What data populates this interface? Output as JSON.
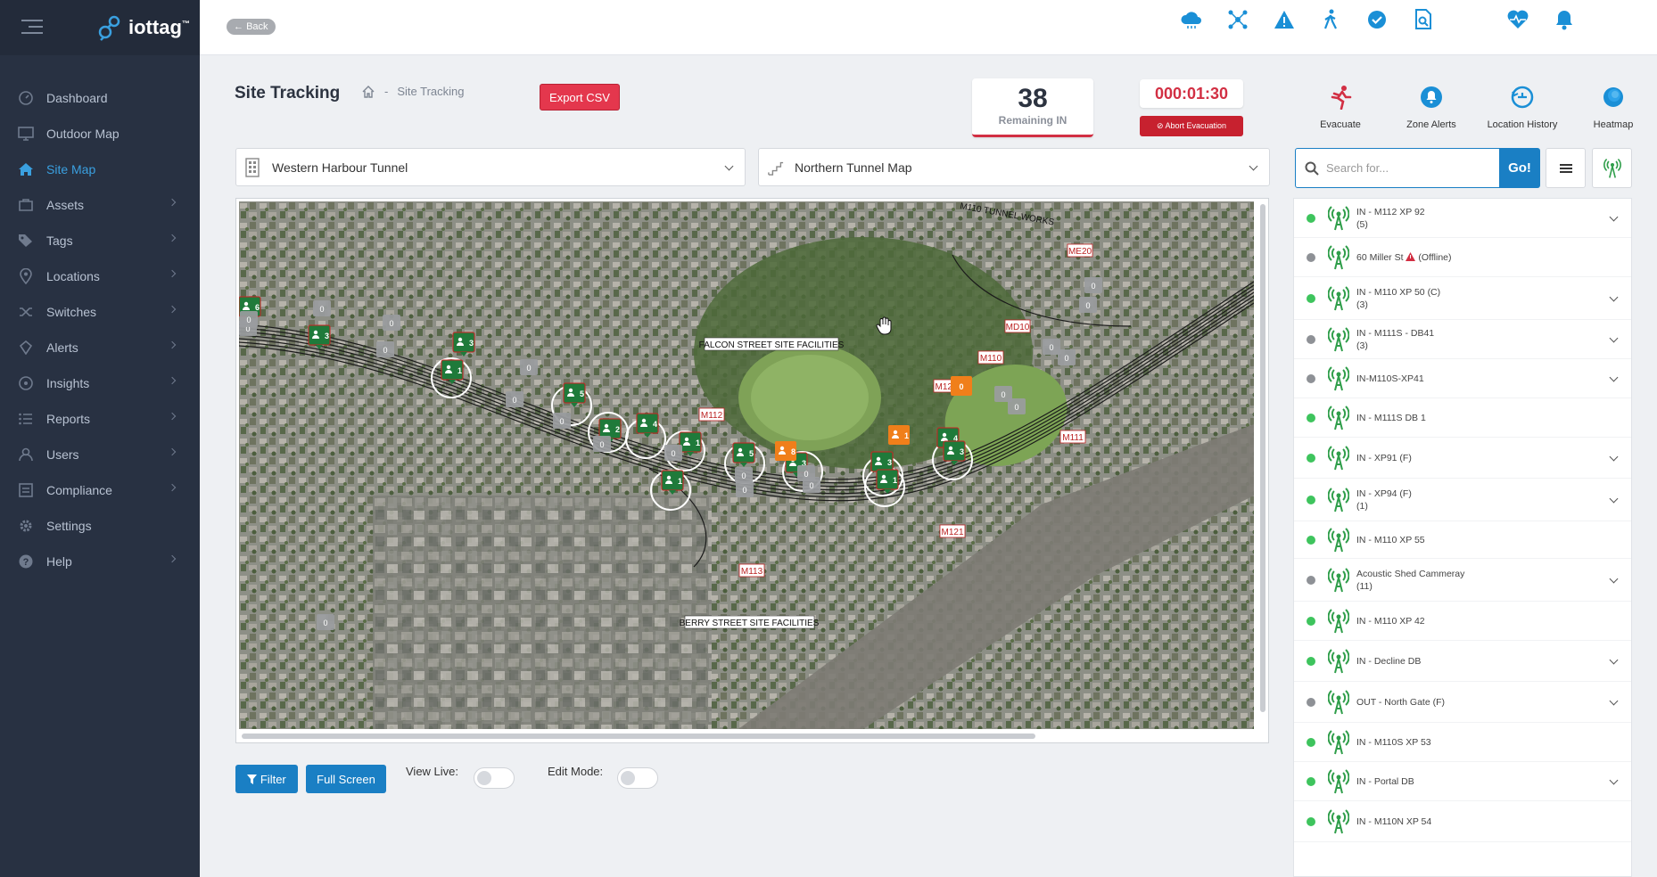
{
  "brand": {
    "name": "iottag",
    "tm": "™"
  },
  "sidebar": {
    "items": [
      {
        "label": "Dashboard",
        "icon": "dashboard-icon",
        "active": false,
        "chevron": false
      },
      {
        "label": "Outdoor Map",
        "icon": "monitor-icon",
        "active": false,
        "chevron": false
      },
      {
        "label": "Site Map",
        "icon": "home-icon",
        "active": true,
        "chevron": false
      },
      {
        "label": "Assets",
        "icon": "assets-icon",
        "active": false,
        "chevron": true
      },
      {
        "label": "Tags",
        "icon": "tag-icon",
        "active": false,
        "chevron": true
      },
      {
        "label": "Locations",
        "icon": "location-pin-icon",
        "active": false,
        "chevron": true
      },
      {
        "label": "Switches",
        "icon": "shuffle-icon",
        "active": false,
        "chevron": true
      },
      {
        "label": "Alerts",
        "icon": "bell-outline-icon",
        "active": false,
        "chevron": true
      },
      {
        "label": "Insights",
        "icon": "insights-icon",
        "active": false,
        "chevron": true
      },
      {
        "label": "Reports",
        "icon": "list-icon",
        "active": false,
        "chevron": true
      },
      {
        "label": "Users",
        "icon": "user-icon",
        "active": false,
        "chevron": true
      },
      {
        "label": "Compliance",
        "icon": "compliance-icon",
        "active": false,
        "chevron": true
      },
      {
        "label": "Settings",
        "icon": "gear-icon",
        "active": false,
        "chevron": false
      },
      {
        "label": "Help",
        "icon": "help-icon",
        "active": false,
        "chevron": true
      }
    ]
  },
  "topbar": {
    "back_label": "Back",
    "icons": [
      "cloud-icon",
      "network-icon",
      "warning-icon",
      "person-walk-icon",
      "check-circle-icon",
      "document-search-icon",
      "heart-pulse-icon",
      "bell-icon"
    ],
    "accent": "#1a8fd6"
  },
  "header": {
    "title": "Site Tracking",
    "breadcrumb": "Site Tracking",
    "export_label": "Export CSV"
  },
  "evacuation": {
    "remaining_count": "38",
    "remaining_label": "Remaining IN",
    "timer": "000:01:30",
    "abort_label": "Abort Evacuation"
  },
  "actions": [
    {
      "label": "Evacuate",
      "icon": "running-person-icon"
    },
    {
      "label": "Zone Alerts",
      "icon": "zone-alert-icon"
    },
    {
      "label": "Location History",
      "icon": "history-icon"
    },
    {
      "label": "Heatmap",
      "icon": "heatmap-icon"
    }
  ],
  "selects": {
    "site": "Western Harbour Tunnel",
    "map": "Northern Tunnel Map"
  },
  "map": {
    "labels": {
      "falcon": "FALCON STREET SITE FACILITIES",
      "berry": "BERRY STREET SITE FACILITIES",
      "works": "M110 TUNNEL WORKS"
    },
    "tags": [
      "M112",
      "M110",
      "MD10",
      "ME20",
      "M111",
      "M120",
      "M121",
      "M113"
    ],
    "green_counts": [
      "6",
      "3",
      "3",
      "1",
      "5",
      "2",
      "4",
      "1",
      "1",
      "5",
      "3",
      "3",
      "1",
      "4",
      "3"
    ],
    "orange_counts": [
      "0",
      "1",
      "8"
    ],
    "grey_counts": [
      "0",
      "0",
      "0",
      "0",
      "0",
      "0",
      "0",
      "0",
      "0",
      "0",
      "0",
      "0",
      "0",
      "0",
      "0",
      "0",
      "0",
      "0",
      "0",
      "0",
      "0"
    ]
  },
  "controls": {
    "filter_label": "Filter",
    "fullscreen_label": "Full Screen",
    "view_live_label": "View Live:",
    "edit_mode_label": "Edit Mode:"
  },
  "search": {
    "placeholder": "Search for...",
    "go_label": "Go!"
  },
  "devices": [
    {
      "name": "IN - M112 XP 92",
      "count": "(5)",
      "status": "online",
      "expand": true,
      "warn": false
    },
    {
      "name": "60 Miller St",
      "suffix": "(Offline)",
      "count": "",
      "status": "offline",
      "expand": false,
      "warn": true
    },
    {
      "name": "IN - M110 XP 50 (C)",
      "count": "(3)",
      "status": "online",
      "expand": true,
      "warn": false
    },
    {
      "name": "IN - M111S - DB41",
      "count": "(3)",
      "status": "offline",
      "expand": true,
      "warn": false
    },
    {
      "name": "IN-M110S-XP41",
      "count": "",
      "status": "offline",
      "expand": true,
      "warn": false
    },
    {
      "name": "IN - M111S DB 1",
      "count": "",
      "status": "online",
      "expand": false,
      "warn": false
    },
    {
      "name": "IN - XP91 (F)",
      "count": "",
      "status": "online",
      "expand": true,
      "warn": false
    },
    {
      "name": "IN - XP94 (F)",
      "count": "(1)",
      "status": "online",
      "expand": true,
      "warn": false
    },
    {
      "name": "IN - M110 XP 55",
      "count": "",
      "status": "online",
      "expand": false,
      "warn": false
    },
    {
      "name": "Acoustic Shed Cammeray",
      "count": "(11)",
      "status": "offline",
      "expand": true,
      "warn": false
    },
    {
      "name": "IN - M110 XP 42",
      "count": "",
      "status": "online",
      "expand": false,
      "warn": false
    },
    {
      "name": "IN - Decline DB",
      "count": "",
      "status": "online",
      "expand": true,
      "warn": false
    },
    {
      "name": "OUT - North Gate (F)",
      "count": "",
      "status": "offline",
      "expand": true,
      "warn": false
    },
    {
      "name": "IN - M110S XP 53",
      "count": "",
      "status": "online",
      "expand": false,
      "warn": false
    },
    {
      "name": "IN - Portal DB",
      "count": "",
      "status": "online",
      "expand": true,
      "warn": false
    },
    {
      "name": "IN - M110N XP 54",
      "count": "",
      "status": "online",
      "expand": false,
      "warn": false
    }
  ],
  "colors": {
    "online": "#3ec45d",
    "offline": "#8e9196",
    "green_marker": "#1f7a3a",
    "orange_marker": "#f07f1a",
    "danger": "#d22f43"
  }
}
